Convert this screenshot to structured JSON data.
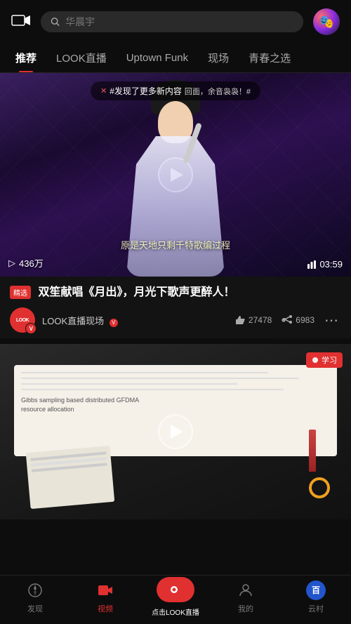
{
  "app": {
    "title": "华晨宇"
  },
  "topbar": {
    "search_placeholder": "华晨宇",
    "camera_label": "camera"
  },
  "nav": {
    "tabs": [
      {
        "id": "recommend",
        "label": "推荐",
        "active": true
      },
      {
        "id": "look-live",
        "label": "LOOK直播",
        "active": false
      },
      {
        "id": "uptown-funk",
        "label": "Uptown Funk",
        "active": false
      },
      {
        "id": "scene",
        "label": "现场",
        "active": false
      },
      {
        "id": "youth",
        "label": "青春之选",
        "active": false
      }
    ]
  },
  "video1": {
    "discovery_text": "#发现了更多新内容",
    "discovery_suffix": "回面，余音袅袅！#",
    "subtitle": "原是天地只剩千特歌编过程",
    "play_count": "436万",
    "duration": "03:59",
    "featured_badge": "精选",
    "title": "双笙献唱《月出》，月光下歌声更醉人！",
    "channel": "LOOK直播现场",
    "likes": "27478",
    "shares": "6983"
  },
  "video2": {
    "tag": "学习",
    "text1": "Gibbs sampling based distributed GFDMA",
    "text2": "resource allocation"
  },
  "bottom_nav": {
    "items": [
      {
        "id": "discover",
        "label": "发现",
        "icon": "compass"
      },
      {
        "id": "video",
        "label": "视频",
        "icon": "video",
        "active": true
      },
      {
        "id": "look-live",
        "label": "点击LOOK直播",
        "icon": "look",
        "center": true
      },
      {
        "id": "mine",
        "label": "我的",
        "icon": "user"
      },
      {
        "id": "baidu",
        "label": "云村",
        "icon": "baidu"
      }
    ]
  }
}
